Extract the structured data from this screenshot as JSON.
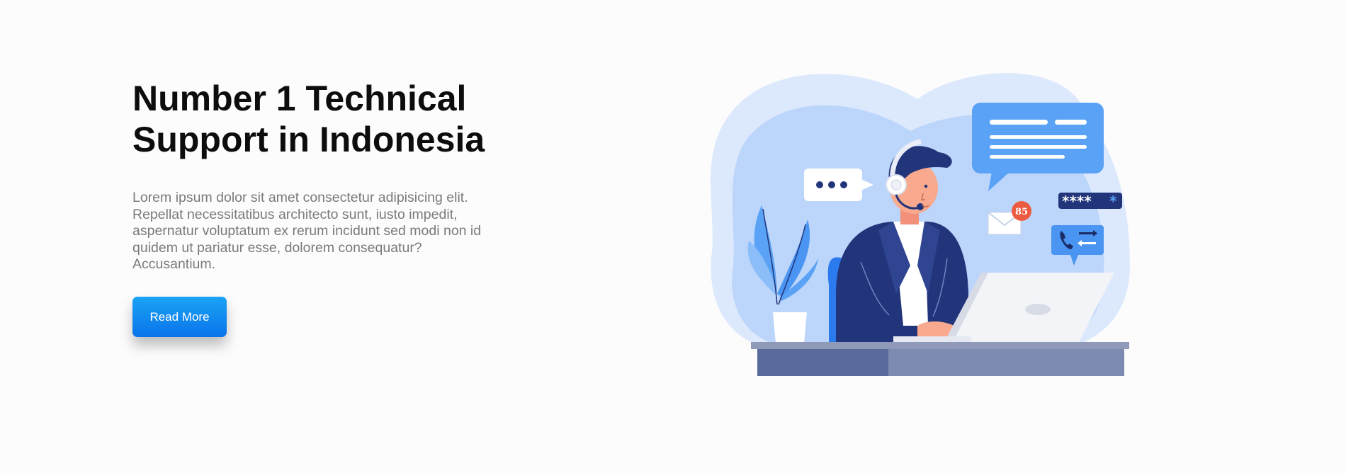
{
  "hero": {
    "title_line1": "Number 1 Technical",
    "title_line2": "Support in Indonesia",
    "description": "Lorem ipsum dolor sit amet consectetur adipisicing elit. Repellat necessitatibus architecto sunt, iusto impedit, aspernatur voluptatum ex rerum incidunt sed modi non id quidem ut pariatur esse, dolorem consequatur? Accusantium.",
    "button_label": "Read More"
  },
  "illustration": {
    "badge_count": "85",
    "password_mask": "****",
    "password_mask_last": "*"
  },
  "colors": {
    "accent": "#0a74ea",
    "accent_light": "#1aa3f5",
    "title": "#0d0d0d",
    "text_muted": "#7a7a7a",
    "blob_light": "#dce9fd",
    "blob_mid": "#bcd5fb",
    "navy": "#23357a"
  },
  "icons": [
    "chat-bubble-icon",
    "typing-bubble-icon",
    "mail-icon",
    "phone-transfer-icon",
    "password-field-icon",
    "headset-icon"
  ]
}
